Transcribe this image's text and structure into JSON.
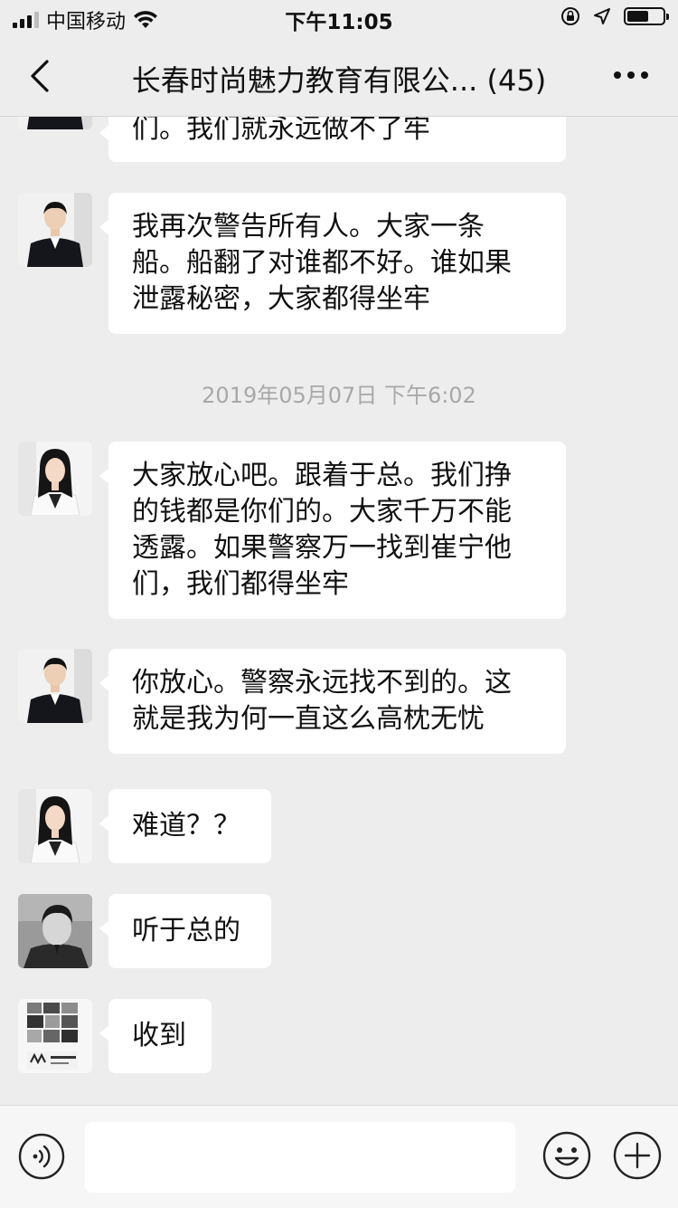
{
  "status_bar": {
    "carrier": "中国移动",
    "time": "下午11:05"
  },
  "header": {
    "title": "长春时尚魅力教育有限公... (45)"
  },
  "chat": {
    "timestamp": "2019年05月07日 下午6:02",
    "messages": [
      {
        "sender": "male-uniform",
        "lines": [
          "们。我们就永远做不了牢"
        ]
      },
      {
        "sender": "male-uniform",
        "lines": [
          "我再次警告所有人。大家一条",
          "船。船翻了对谁都不好。谁如果",
          "泄露秘密，大家都得坐牢"
        ]
      },
      {
        "sender": "female",
        "lines": [
          "大家放心吧。跟着于总。我们挣",
          "的钱都是你们的。大家千万不能",
          "透露。如果警察万一找到崔宁他",
          "们，我们都得坐牢"
        ]
      },
      {
        "sender": "male-uniform",
        "lines": [
          "你放心。警察永远找不到的。这",
          "就是我为何一直这么高枕无忧"
        ]
      },
      {
        "sender": "female",
        "lines": [
          "难道？？"
        ]
      },
      {
        "sender": "male-bw",
        "lines": [
          "听于总的"
        ]
      },
      {
        "sender": "collage",
        "lines": [
          "收到"
        ]
      }
    ]
  },
  "input_bar": {
    "placeholder": ""
  },
  "colors": {
    "background": "#ededed",
    "bubble": "#ffffff",
    "timestamp": "#a8a8a8"
  },
  "icons": {
    "back": "chevron-left-icon",
    "more": "more-dots-icon",
    "voice": "voice-icon",
    "emoji": "emoji-icon",
    "plus": "plus-icon"
  }
}
